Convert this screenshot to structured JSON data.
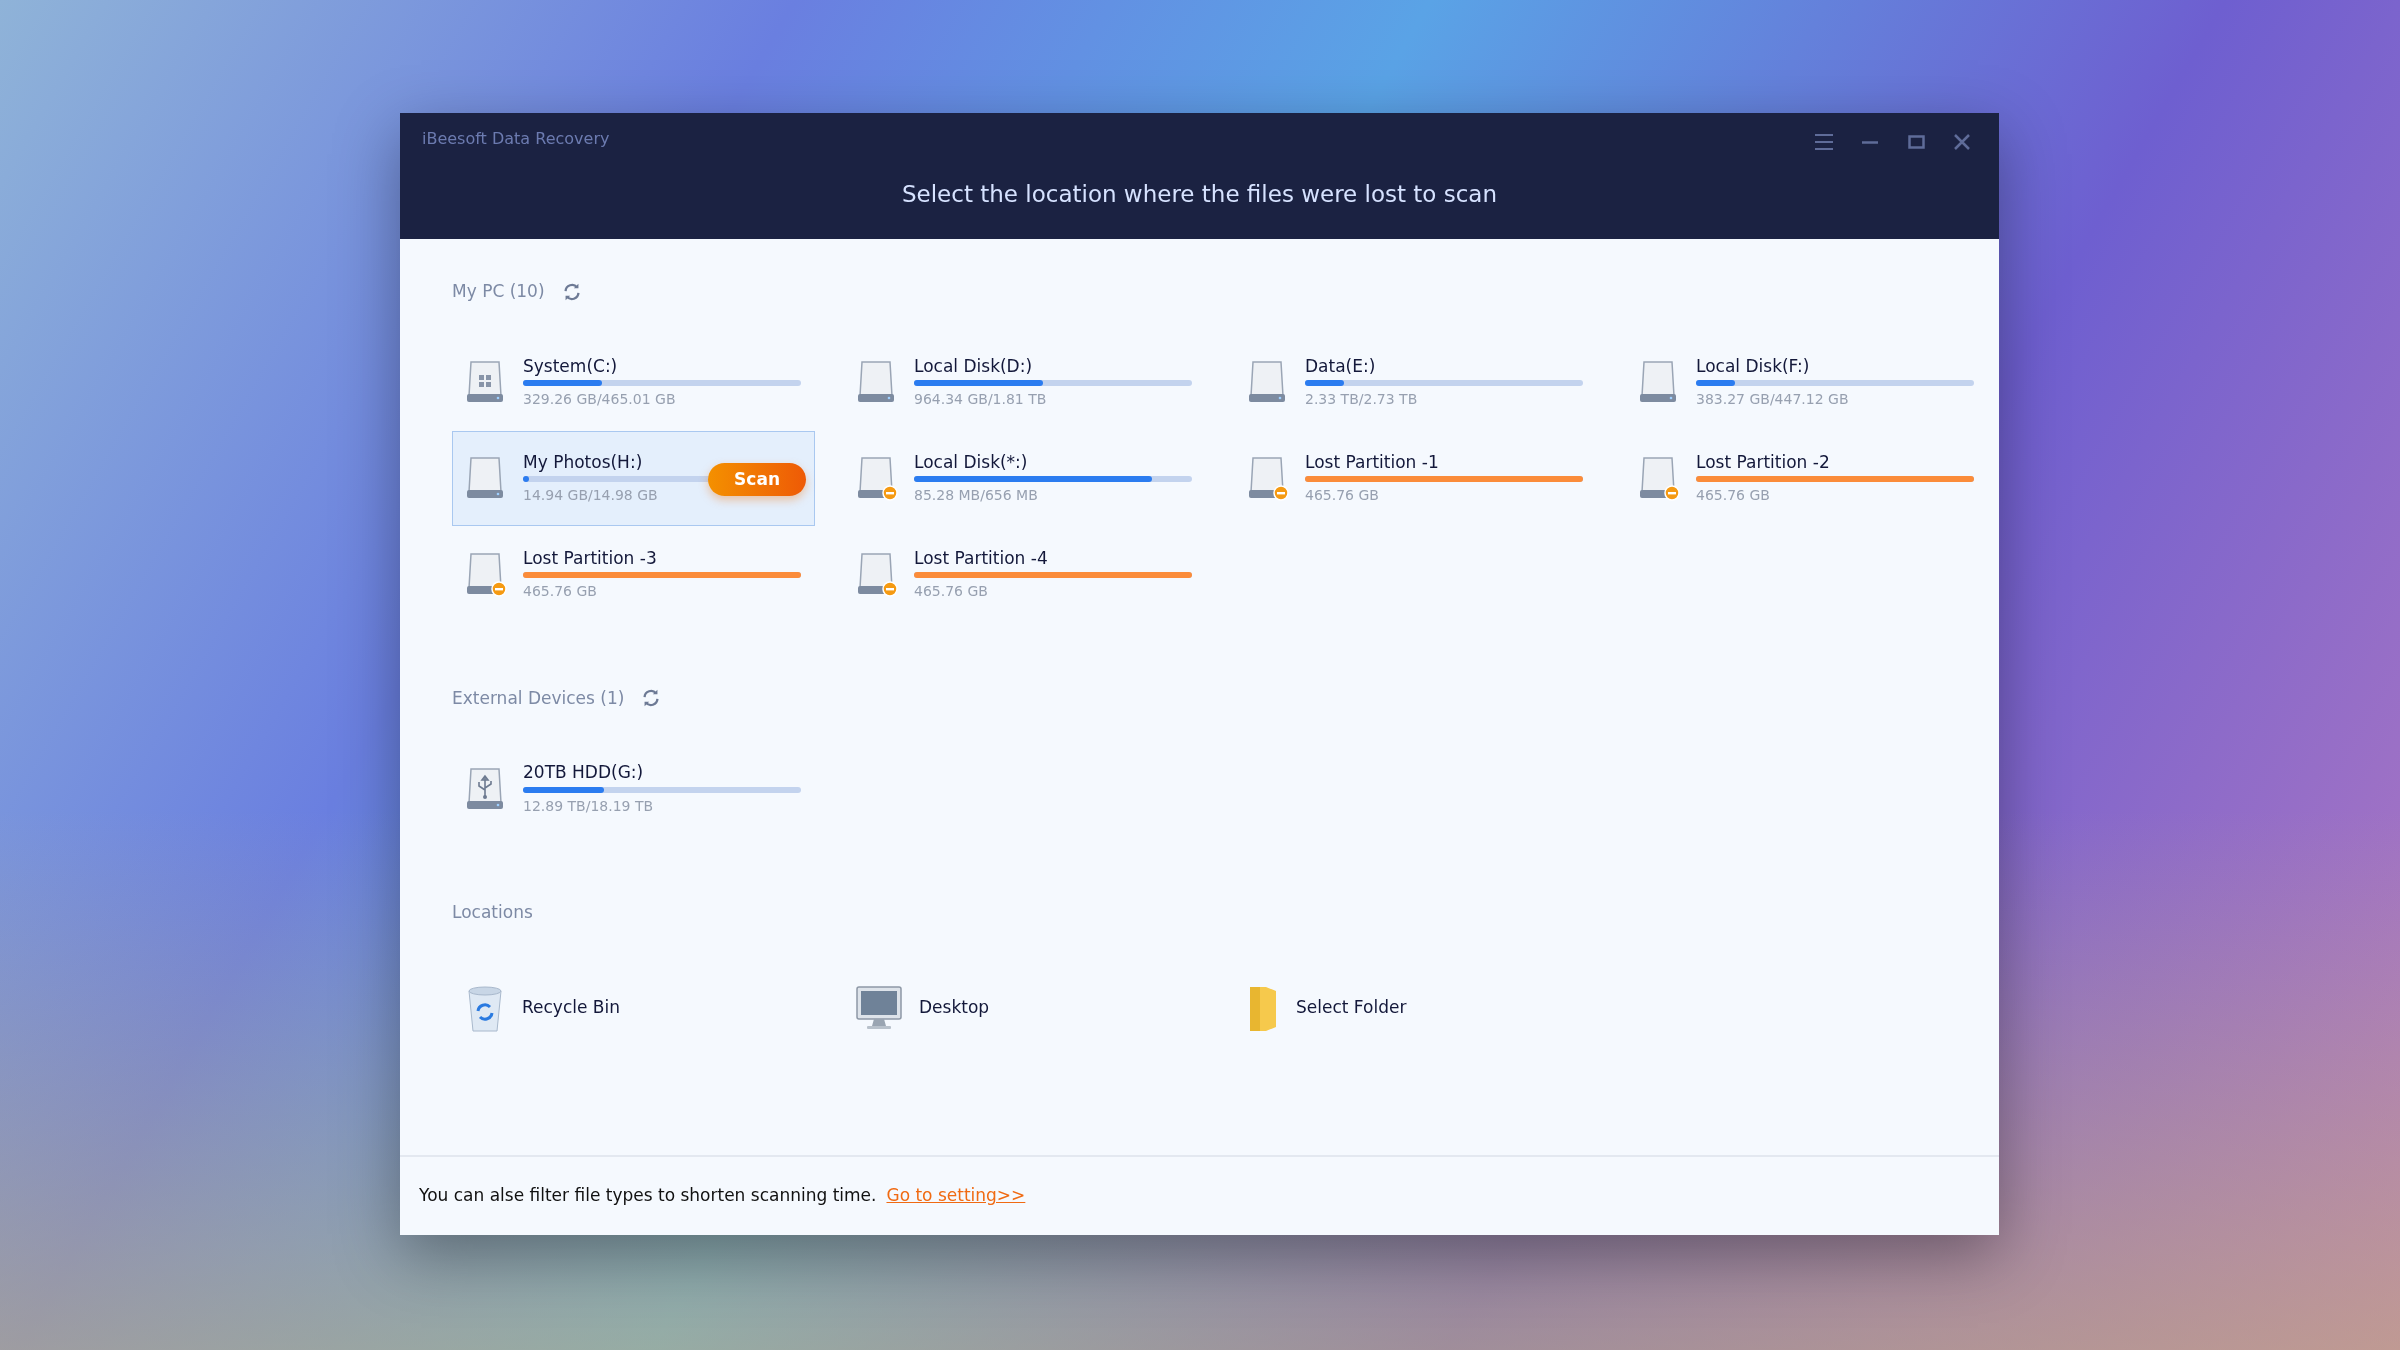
{
  "window": {
    "title": "iBeesoft Data Recovery",
    "heading": "Select the location where the files were lost to scan"
  },
  "sections": [
    {
      "kind": "drives",
      "label": "My PC (10)",
      "refresh": true,
      "items": [
        {
          "kind": "system",
          "name": "System(C:)",
          "size": "329.26 GB/465.01 GB",
          "level": 0.285,
          "lost": false,
          "selected": false
        },
        {
          "kind": "disk",
          "name": "Local Disk(D:)",
          "size": "964.34 GB/1.81 TB",
          "level": 0.465,
          "lost": false,
          "selected": false
        },
        {
          "kind": "disk",
          "name": "Data(E:)",
          "size": "2.33 TB/2.73 TB",
          "level": 0.14,
          "lost": false,
          "selected": false
        },
        {
          "kind": "disk",
          "name": "Local Disk(F:)",
          "size": "383.27 GB/447.12 GB",
          "level": 0.14,
          "lost": false,
          "selected": false
        },
        {
          "kind": "disk",
          "name": "My Photos(H:)",
          "size": "14.94 GB/14.98 GB",
          "level": 0.02,
          "lost": false,
          "selected": true,
          "action": "Scan"
        },
        {
          "kind": "disk",
          "name": "Local Disk(*:)",
          "size": "85.28 MB/656 MB",
          "level": 0.857,
          "lost": true,
          "selected": false
        },
        {
          "kind": "partition",
          "name": "Lost Partition -1",
          "size": "465.76 GB",
          "level": 1,
          "lost": true,
          "selected": false
        },
        {
          "kind": "partition",
          "name": "Lost Partition -2",
          "size": "465.76 GB",
          "level": 1,
          "lost": true,
          "selected": false
        },
        {
          "kind": "partition",
          "name": "Lost Partition -3",
          "size": "465.76 GB",
          "level": 1,
          "lost": true,
          "selected": false
        },
        {
          "kind": "partition",
          "name": "Lost Partition -4",
          "size": "465.76 GB",
          "level": 1,
          "lost": true,
          "selected": false
        }
      ]
    },
    {
      "kind": "drives",
      "label": "External Devices (1)",
      "refresh": true,
      "items": [
        {
          "kind": "usb",
          "name": "20TB HDD(G:)",
          "size": "12.89 TB/18.19 TB",
          "level": 0.29,
          "lost": false,
          "selected": false
        }
      ]
    },
    {
      "kind": "locations",
      "label": "Locations",
      "refresh": false,
      "items": [
        {
          "kind": "recycle",
          "name": "Recycle Bin"
        },
        {
          "kind": "desktop",
          "name": "Desktop"
        },
        {
          "kind": "folder",
          "name": "Select Folder"
        }
      ]
    }
  ],
  "footer": {
    "text": "You can alse filter file types to shorten scanning time.",
    "link": "Go to setting>>"
  }
}
